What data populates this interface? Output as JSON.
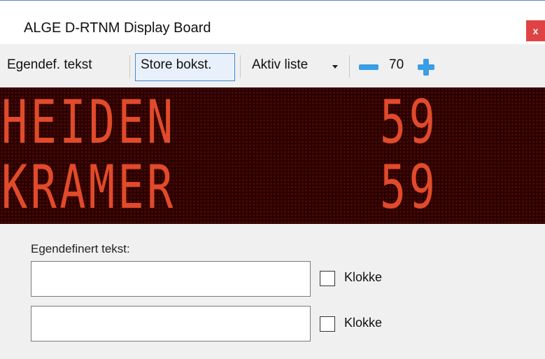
{
  "window": {
    "title": "ALGE D-RTNM Display Board",
    "close_label": "x"
  },
  "toolbar": {
    "custom_text_label": "Egendef. tekst",
    "uppercase_label": "Store bokst.",
    "active_list_label": "Aktiv liste",
    "size_value": "70"
  },
  "board": {
    "rows": [
      {
        "name": "HEIDEN",
        "score": "59"
      },
      {
        "name": "KRAMER",
        "score": "59"
      }
    ]
  },
  "custom_panel": {
    "label": "Egendefinert tekst:",
    "fields": [
      {
        "value": "",
        "clock_label": "Klokke",
        "clock_checked": false
      },
      {
        "value": "",
        "clock_label": "Klokke",
        "clock_checked": false
      }
    ]
  },
  "colors": {
    "led_on": "#e14a2a",
    "board_bg": "#2a0000",
    "accent": "#3a9ee4",
    "close": "#e04343"
  }
}
